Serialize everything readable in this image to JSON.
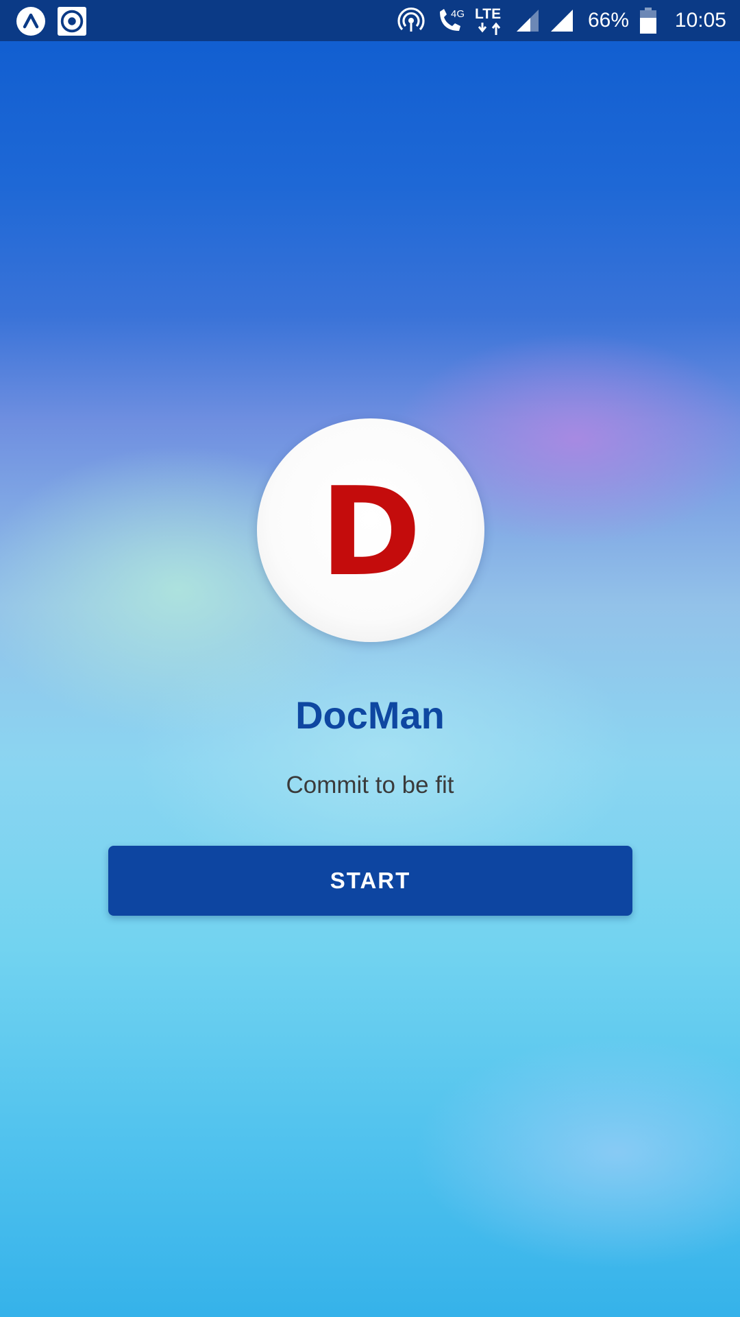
{
  "status_bar": {
    "left_icons": [
      "expo-launcher-icon",
      "record-target-icon"
    ],
    "right_icons": [
      "hotspot-icon",
      "call-4g-icon",
      "lte-data-icon",
      "signal-strength-icon",
      "signal-strength-full-icon",
      "battery-icon"
    ],
    "network_4g_label": "4G",
    "lte_label": "LTE",
    "battery_percent": "66%",
    "time": "10:05"
  },
  "splash": {
    "logo_letter": "D",
    "app_name": "DocMan",
    "tagline": "Commit to be fit",
    "start_label": "START"
  },
  "colors": {
    "status_bar_bg": "#0b3a86",
    "title": "#0e47a1",
    "button_bg": "#0d45a1",
    "logo_letter": "#c40c0c",
    "tagline": "#3a3a3a"
  }
}
